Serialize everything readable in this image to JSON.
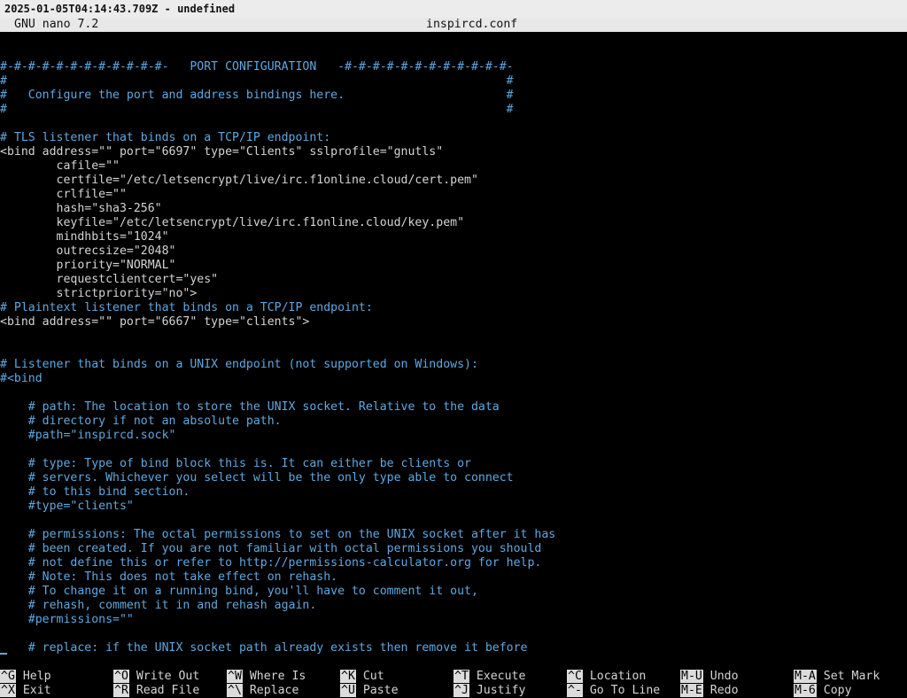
{
  "window": {
    "title": "2025-01-05T04:14:43.709Z - undefined"
  },
  "nano": {
    "version": "GNU nano 7.2",
    "filename": "inspircd.conf"
  },
  "lines": [
    {
      "text": "",
      "kind": "t"
    },
    {
      "text": "",
      "kind": "t"
    },
    {
      "text": "#-#-#-#-#-#-#-#-#-#-#-#-   PORT CONFIGURATION   -#-#-#-#-#-#-#-#-#-#-#-#-",
      "kind": "c"
    },
    {
      "text": "#                                                                       #",
      "kind": "c"
    },
    {
      "text": "#   Configure the port and address bindings here.                       #",
      "kind": "c"
    },
    {
      "text": "#                                                                       #",
      "kind": "c"
    },
    {
      "text": "",
      "kind": "t"
    },
    {
      "text": "# TLS listener that binds on a TCP/IP endpoint:",
      "kind": "c"
    },
    {
      "text": "<bind address=\"\" port=\"6697\" type=\"Clients\" sslprofile=\"gnutls\"",
      "kind": "t"
    },
    {
      "text": "        cafile=\"\"",
      "kind": "t"
    },
    {
      "text": "        certfile=\"/etc/letsencrypt/live/irc.f1online.cloud/cert.pem\"",
      "kind": "t"
    },
    {
      "text": "        crlfile=\"\"",
      "kind": "t"
    },
    {
      "text": "        hash=\"sha3-256\"",
      "kind": "t"
    },
    {
      "text": "        keyfile=\"/etc/letsencrypt/live/irc.f1online.cloud/key.pem\"",
      "kind": "t"
    },
    {
      "text": "        mindhbits=\"1024\"",
      "kind": "t"
    },
    {
      "text": "        outrecsize=\"2048\"",
      "kind": "t"
    },
    {
      "text": "        priority=\"NORMAL\"",
      "kind": "t"
    },
    {
      "text": "        requestclientcert=\"yes\"",
      "kind": "t"
    },
    {
      "text": "        strictpriority=\"no\">",
      "kind": "t"
    },
    {
      "text": "# Plaintext listener that binds on a TCP/IP endpoint:",
      "kind": "c"
    },
    {
      "text": "<bind address=\"\" port=\"6667\" type=\"clients\">",
      "kind": "t"
    },
    {
      "text": "",
      "kind": "t"
    },
    {
      "text": "",
      "kind": "t"
    },
    {
      "text": "# Listener that binds on a UNIX endpoint (not supported on Windows):",
      "kind": "c"
    },
    {
      "text": "#<bind",
      "kind": "c"
    },
    {
      "text": "",
      "kind": "t"
    },
    {
      "text": "    # path: The location to store the UNIX socket. Relative to the data",
      "kind": "c"
    },
    {
      "text": "    # directory if not an absolute path.",
      "kind": "c"
    },
    {
      "text": "    #path=\"inspircd.sock\"",
      "kind": "c"
    },
    {
      "text": "",
      "kind": "t"
    },
    {
      "text": "    # type: Type of bind block this is. It can either be clients or",
      "kind": "c"
    },
    {
      "text": "    # servers. Whichever you select will be the only type able to connect",
      "kind": "c"
    },
    {
      "text": "    # to this bind section.",
      "kind": "c"
    },
    {
      "text": "    #type=\"clients\"",
      "kind": "c"
    },
    {
      "text": "",
      "kind": "t"
    },
    {
      "text": "    # permissions: The octal permissions to set on the UNIX socket after it has",
      "kind": "c"
    },
    {
      "text": "    # been created. If you are not familiar with octal permissions you should",
      "kind": "c"
    },
    {
      "text": "    # not define this or refer to http://permissions-calculator.org for help.",
      "kind": "c"
    },
    {
      "text": "    # Note: This does not take effect on rehash.",
      "kind": "c"
    },
    {
      "text": "    # To change it on a running bind, you'll have to comment it out,",
      "kind": "c"
    },
    {
      "text": "    # rehash, comment it in and rehash again.",
      "kind": "c"
    },
    {
      "text": "    #permissions=\"\"",
      "kind": "c"
    },
    {
      "text": "",
      "kind": "t"
    },
    {
      "text": "    # replace: if the UNIX socket path already exists then remove it before",
      "kind": "c"
    }
  ],
  "shortcuts": [
    {
      "key": "^G",
      "label": "Help"
    },
    {
      "key": "^X",
      "label": "Exit"
    },
    {
      "key": "^O",
      "label": "Write Out"
    },
    {
      "key": "^R",
      "label": "Read File"
    },
    {
      "key": "^W",
      "label": "Where Is"
    },
    {
      "key": "^\\",
      "label": "Replace"
    },
    {
      "key": "^K",
      "label": "Cut"
    },
    {
      "key": "^U",
      "label": "Paste"
    },
    {
      "key": "^T",
      "label": "Execute"
    },
    {
      "key": "^J",
      "label": "Justify"
    },
    {
      "key": "^C",
      "label": "Location"
    },
    {
      "key": "^-",
      "label": "Go To Line"
    },
    {
      "key": "M-U",
      "label": "Undo"
    },
    {
      "key": "M-E",
      "label": "Redo"
    },
    {
      "key": "M-A",
      "label": "Set Mark"
    },
    {
      "key": "M-6",
      "label": "Copy"
    }
  ]
}
